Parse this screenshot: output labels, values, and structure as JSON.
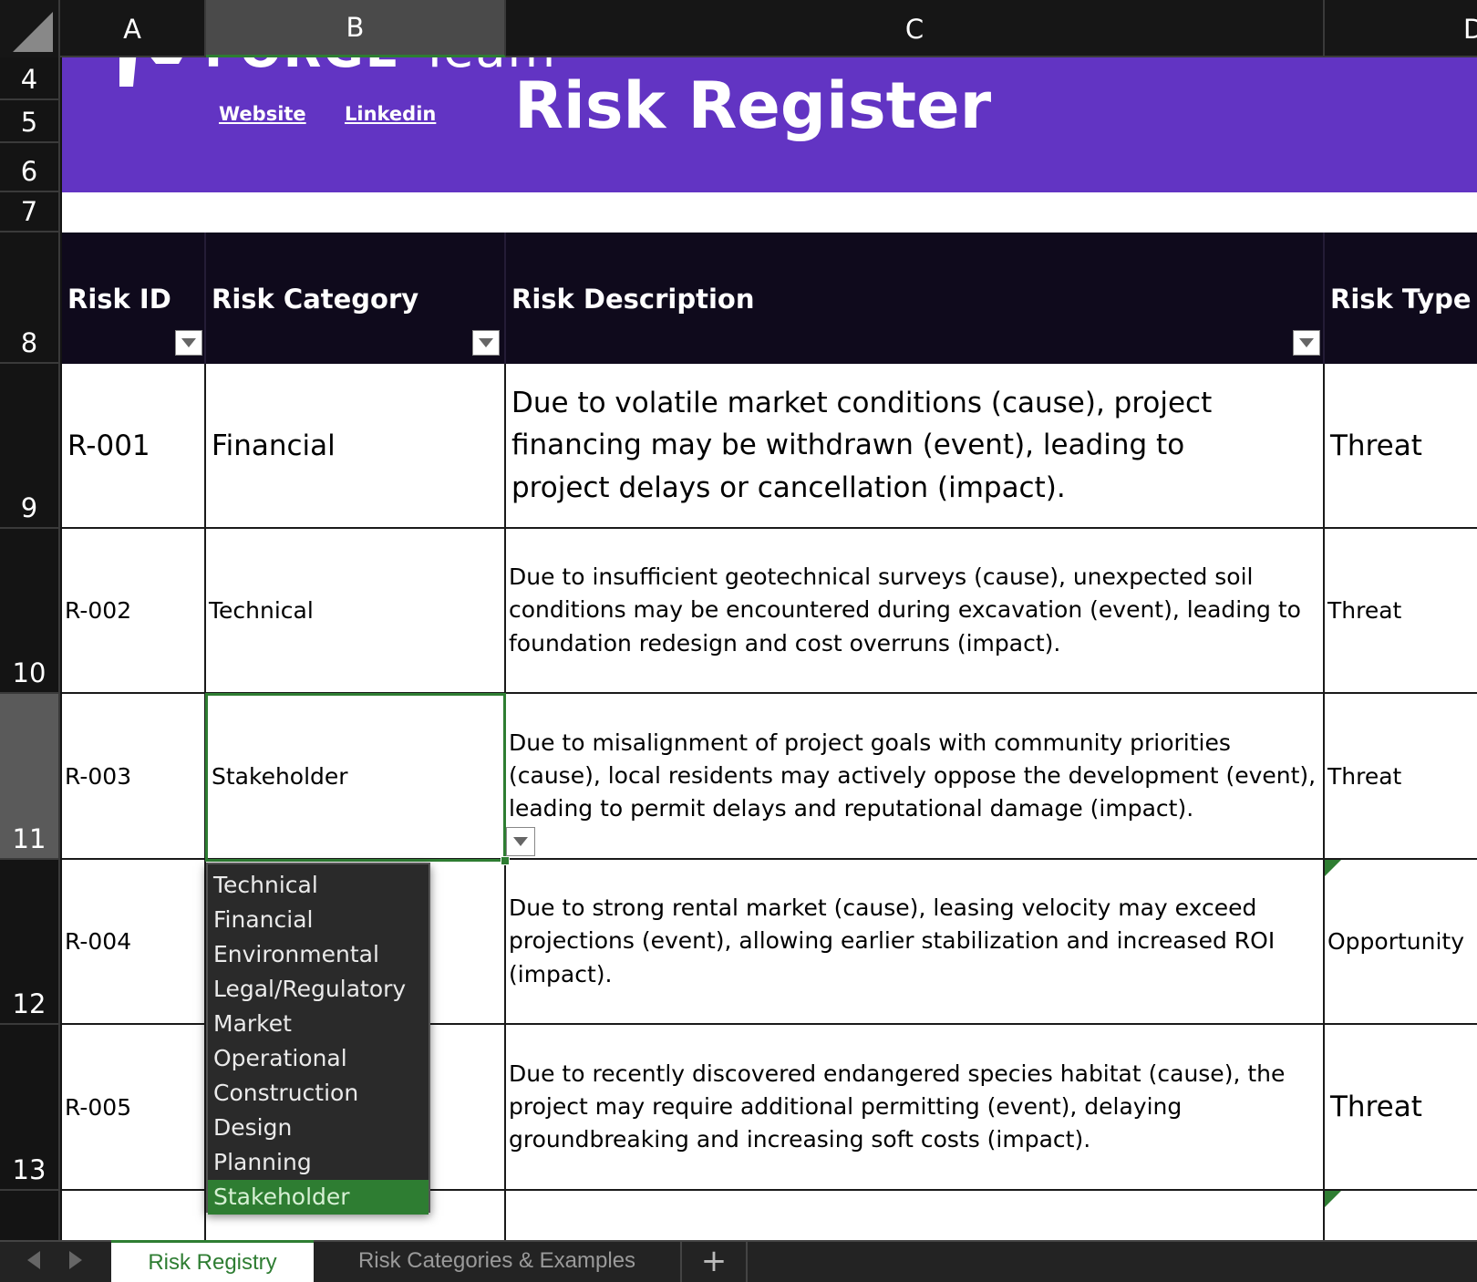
{
  "columns": [
    "A",
    "B",
    "C",
    "D"
  ],
  "rows": [
    "4",
    "5",
    "6",
    "7",
    "8",
    "9",
    "10",
    "11",
    "12",
    "13"
  ],
  "selected_column": "B",
  "selected_row": "11",
  "banner": {
    "logo_text_bold": "FORGE",
    "logo_text_thin": "Team",
    "website_link": "Website",
    "linkedin_link": "Linkedin",
    "title": "Risk Register",
    "background": "#6234c3"
  },
  "headers": {
    "risk_id": "Risk ID",
    "risk_category": "Risk Category",
    "risk_description": "Risk Description",
    "risk_type": "Risk Type"
  },
  "records": [
    {
      "id": "R-001",
      "category": "Financial",
      "description": "Due to volatile market conditions (cause), project financing may be withdrawn (event), leading to project delays or cancellation (impact).",
      "type": "Threat"
    },
    {
      "id": "R-002",
      "category": "Technical",
      "description": "Due to insufficient geotechnical surveys (cause), unexpected soil conditions may be encountered during excavation (event), leading to foundation redesign and cost overruns (impact).",
      "type": "Threat"
    },
    {
      "id": "R-003",
      "category": "Stakeholder",
      "description": "Due to misalignment of project goals with community priorities (cause), local residents may actively oppose the development (event), leading to permit delays and reputational damage (impact).",
      "type": "Threat"
    },
    {
      "id": "R-004",
      "category": "",
      "description": "Due to strong rental market (cause), leasing velocity may exceed projections (event), allowing earlier stabilization and increased ROI (impact).",
      "type": "Opportunity"
    },
    {
      "id": "R-005",
      "category": "",
      "description": "Due to recently discovered endangered species habitat (cause), the project may require additional permitting (event), delaying groundbreaking and increasing soft costs (impact).",
      "type": "Threat"
    }
  ],
  "dropdown": {
    "options": [
      "Technical",
      "Financial",
      "Environmental",
      "Legal/Regulatory",
      "Market",
      "Operational",
      "Construction",
      "Design",
      "Planning",
      "Stakeholder"
    ],
    "selected": "Stakeholder"
  },
  "tabs": {
    "active": "Risk Registry",
    "other": "Risk Categories & Examples",
    "add": "+"
  },
  "colors": {
    "accent_green": "#2e7d32",
    "header_dark": "#0f0a1c"
  }
}
